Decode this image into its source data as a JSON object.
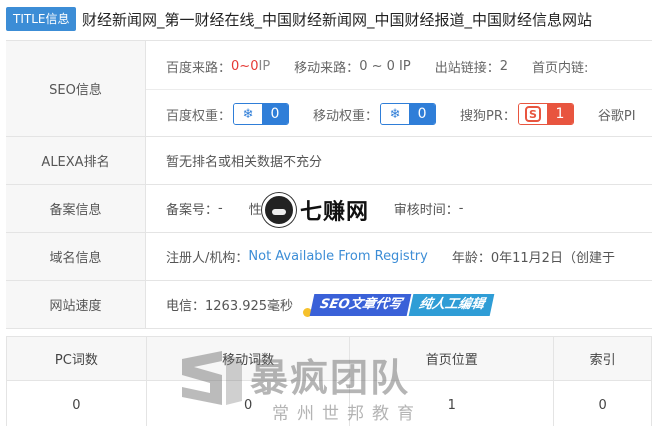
{
  "title_bar": {
    "badge": "TITLE信息",
    "text": "财经新闻网_第一财经在线_中国财经新闻网_中国财经报道_中国财经信息网站"
  },
  "seo": {
    "label": "SEO信息",
    "baidu_source_label": "百度来路：",
    "baidu_source_low": "0",
    "baidu_source_sep": " ~ ",
    "baidu_source_high": "0",
    "baidu_source_unit": " IP",
    "mobile_source_label": "移动来路：",
    "mobile_source_value": "0 ~ 0 IP",
    "outbound_label": "出站链接：",
    "outbound_value": "2",
    "homepage_inner_label": "首页内链:",
    "baidu_weight_label": "百度权重：",
    "baidu_weight_value": "0",
    "mobile_weight_label": "移动权重：",
    "mobile_weight_value": "0",
    "sogou_pr_label": "搜狗PR：",
    "sogou_pr_value": "1",
    "google_pr_label": "谷歌PI"
  },
  "alexa": {
    "label": "ALEXA排名",
    "value": "暂无排名或相关数据不充分"
  },
  "beian": {
    "label": "备案信息",
    "number_label": "备案号：",
    "number_value": "-",
    "nature_label": "性",
    "review_label": "审核时间：",
    "review_value": "-"
  },
  "domain": {
    "label": "域名信息",
    "registrant_label": "注册人/机构：",
    "registrant_value": "Not Available From Registry",
    "age_label": "年龄：",
    "age_value": "0年11月2日（创建于"
  },
  "speed": {
    "label": "网站速度",
    "value": "电信：1263.925毫秒",
    "promo_a": "SEO文章代写",
    "promo_b": "纯人工编辑"
  },
  "watermark_mid": {
    "text": "七赚网"
  },
  "keywords": {
    "headers": [
      "PC词数",
      "移动词数",
      "首页位置",
      "索引"
    ],
    "values": [
      "0",
      "0",
      "1",
      "0"
    ]
  },
  "watermark_bottom": {
    "big": "暴疯团队",
    "small": "常州世邦教育"
  },
  "colors": {
    "accent_blue": "#3c8dd6",
    "badge_blue": "#2f7ed8",
    "badge_red": "#e8553f",
    "red_text": "#e53935"
  }
}
